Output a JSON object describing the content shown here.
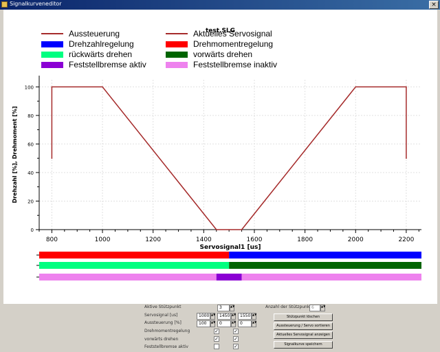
{
  "window": {
    "title": "Signalkurveneditor",
    "close_label": "×"
  },
  "plot": {
    "title": "test.SLG",
    "legend": [
      {
        "label": "Aussteuerung",
        "kind": "line",
        "color": "#a52a2a"
      },
      {
        "label": "Aktuelles Servosignal",
        "kind": "line",
        "color": "#a52a2a"
      },
      {
        "label": "Drehzahlregelung",
        "kind": "box",
        "color": "#0000ff"
      },
      {
        "label": "Drehmomentregelung",
        "kind": "box",
        "color": "#ff0000"
      },
      {
        "label": "rückwärts drehen",
        "kind": "box",
        "color": "#00ff80"
      },
      {
        "label": "vorwärts drehen",
        "kind": "box",
        "color": "#006400"
      },
      {
        "label": "Feststellbremse aktiv",
        "kind": "box",
        "color": "#8b00d4"
      },
      {
        "label": "Feststellbremse inaktiv",
        "kind": "box",
        "color": "#ee82ee"
      }
    ]
  },
  "chart_data": {
    "type": "line",
    "title": "test.SLG",
    "xlabel": "Servosignal1 [us]",
    "ylabel": "Drehzahl [%], Drehmoment [%]",
    "xlim": [
      750,
      2260
    ],
    "ylim": [
      0,
      105
    ],
    "xticks": [
      800,
      1000,
      1200,
      1400,
      1600,
      1800,
      2000,
      2200
    ],
    "yticks": [
      0,
      20,
      40,
      60,
      80,
      100
    ],
    "grid": true,
    "series": [
      {
        "name": "Aussteuerung",
        "color": "#a52a2a",
        "x": [
          800,
          800,
          1000,
          1450,
          1450,
          1550,
          2000,
          2200,
          2200
        ],
        "y": [
          50,
          100,
          100,
          0,
          0,
          0,
          100,
          100,
          50
        ]
      }
    ],
    "bands": [
      {
        "segments": [
          {
            "from": 750,
            "to": 1500,
            "color": "#ff0000"
          },
          {
            "from": 1500,
            "to": 2260,
            "color": "#0000ff"
          }
        ]
      },
      {
        "segments": [
          {
            "from": 750,
            "to": 1500,
            "color": "#00ff80"
          },
          {
            "from": 1500,
            "to": 2260,
            "color": "#006400"
          }
        ]
      },
      {
        "segments": [
          {
            "from": 750,
            "to": 1450,
            "color": "#ee82ee"
          },
          {
            "from": 1450,
            "to": 1550,
            "color": "#8b00d4"
          },
          {
            "from": 1550,
            "to": 2260,
            "color": "#ee82ee"
          }
        ]
      }
    ]
  },
  "controls": {
    "rows": [
      {
        "label": "Aktive Stützpunkt",
        "value": "3"
      },
      {
        "label": "Servosignal [us]",
        "values": [
          "1000",
          "1450",
          "1550"
        ]
      },
      {
        "label": "Aussteuerung [%]",
        "values": [
          "100",
          "0",
          "0"
        ]
      },
      {
        "label": "Drehmomentregelung"
      },
      {
        "label": "vorwärts drehen"
      },
      {
        "label": "Feststellbremse aktiv"
      }
    ],
    "checks": [
      [
        true,
        true
      ],
      [
        true,
        true
      ],
      [
        false,
        true
      ]
    ],
    "right": {
      "label": "Anzahl der Stützpunkte",
      "value": "6",
      "buttons": [
        "Stützpunkt löschen",
        "Aussteuerung / Servo sortieren",
        "Aktuelles Servosignal anzeigen",
        "Signalkurve speichern"
      ]
    }
  }
}
